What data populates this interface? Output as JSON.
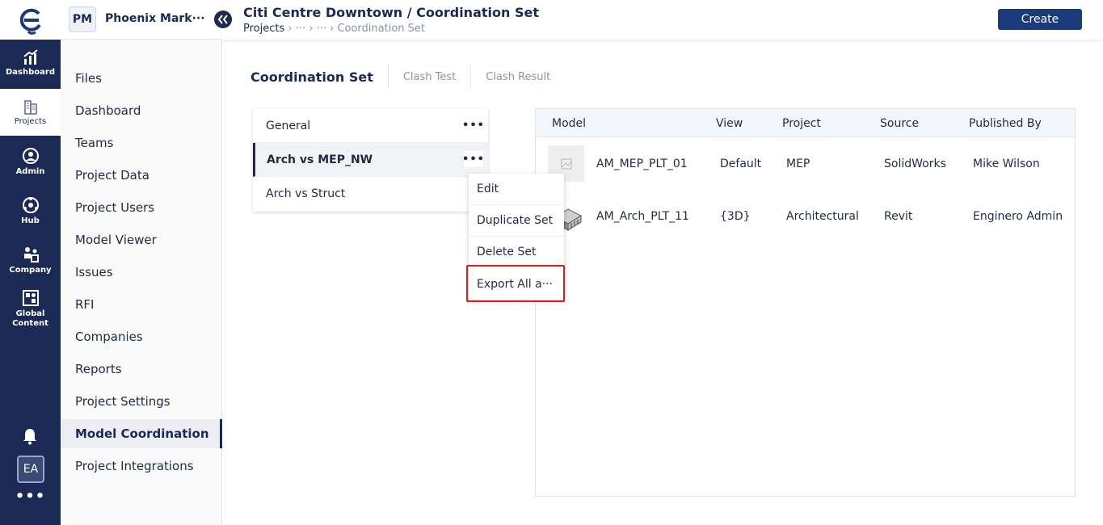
{
  "rail": {
    "items": [
      {
        "label": "Dashboard"
      },
      {
        "label": "Projects"
      },
      {
        "label": "Admin"
      },
      {
        "label": "Hub"
      },
      {
        "label": "Company"
      },
      {
        "label": "Global Content"
      }
    ],
    "user_initials": "EA",
    "more": "•••"
  },
  "sidebar": {
    "project_badge": "PM",
    "project_name": "Phoenix Mark···",
    "items": [
      {
        "label": "Files"
      },
      {
        "label": "Dashboard"
      },
      {
        "label": "Teams"
      },
      {
        "label": "Project Data"
      },
      {
        "label": "Project Users"
      },
      {
        "label": "Model Viewer"
      },
      {
        "label": "Issues"
      },
      {
        "label": "RFI"
      },
      {
        "label": "Companies"
      },
      {
        "label": "Reports"
      },
      {
        "label": "Project Settings"
      },
      {
        "label": "Model Coordination"
      },
      {
        "label": "Project Integrations"
      }
    ],
    "active": "Model Coordination"
  },
  "header": {
    "title": "Citi Centre Downtown / Coordination Set",
    "breadcrumb": {
      "first": "Projects",
      "rest": " › ··· › ··· › Coordination Set"
    },
    "create_label": "Create"
  },
  "tabs": [
    {
      "label": "Coordination Set"
    },
    {
      "label": "Clash Test"
    },
    {
      "label": "Clash Result"
    }
  ],
  "sets": [
    {
      "name": "General"
    },
    {
      "name": "Arch vs MEP_NW"
    },
    {
      "name": "Arch vs Struct"
    }
  ],
  "context_menu": [
    {
      "label": "Edit"
    },
    {
      "label": "Duplicate Set"
    },
    {
      "label": "Delete Set"
    },
    {
      "label": "Export All a···"
    }
  ],
  "models_table": {
    "columns": [
      "Model",
      "View",
      "Project",
      "Source",
      "Published By"
    ],
    "rows": [
      {
        "model": "AM_MEP_PLT_01",
        "view": "Default",
        "project": "MEP",
        "source": "SolidWorks",
        "published_by": "Mike Wilson"
      },
      {
        "model": "AM_Arch_PLT_11",
        "view": "{3D}",
        "project": "Architectural",
        "source": "Revit",
        "published_by": "Enginero Admin"
      }
    ]
  },
  "colors": {
    "primary": "#1b2a55",
    "button": "#1b3a7a",
    "highlight": "#e01b1b"
  }
}
